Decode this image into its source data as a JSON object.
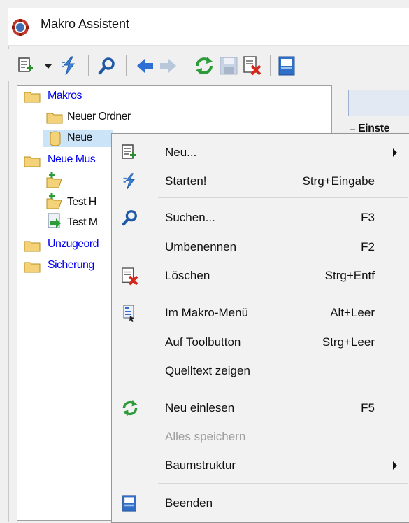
{
  "window": {
    "title": "Makro Assistent",
    "title_icon": "macro-assistant-app-icon"
  },
  "toolbar": {
    "buttons": [
      "new-icon",
      "dropdown-arrow-icon",
      "run-icon",
      "search-icon",
      "back-arrow-icon",
      "forward-arrow-icon",
      "refresh-icon",
      "save-icon",
      "delete-icon",
      "exit-icon"
    ]
  },
  "tree": {
    "items": [
      {
        "label": "Makros",
        "color": "#0000ee"
      },
      {
        "label": "Neuer Ordner",
        "color": "#111111"
      },
      {
        "label": "Neue",
        "color": "#111111",
        "selected": true
      },
      {
        "label": "Neue Mus",
        "color": "#0000ee"
      },
      {
        "label": "",
        "color": "#111111"
      },
      {
        "label": "Test H",
        "color": "#111111"
      },
      {
        "label": "Test M",
        "color": "#111111"
      },
      {
        "label": "Unzugeord",
        "color": "#0000ee"
      },
      {
        "label": "Sicherung",
        "color": "#0000ee"
      }
    ]
  },
  "right_panel": {
    "group_label": "Einste"
  },
  "context_menu": {
    "items": [
      {
        "label": "Neu...",
        "shortcut": "",
        "icon": "new-icon",
        "submenu": true
      },
      {
        "label": "Starten!",
        "shortcut": "Strg+Eingabe",
        "icon": "run-icon"
      },
      {
        "label": "Suchen...",
        "shortcut": "F3",
        "icon": "search-icon"
      },
      {
        "label": "Umbenennen",
        "shortcut": "F2",
        "icon": ""
      },
      {
        "label": "Löschen",
        "shortcut": "Strg+Entf",
        "icon": "delete-icon"
      },
      {
        "label": "Im Makro-Menü",
        "shortcut": "Alt+Leer",
        "icon": "menu-macro-icon"
      },
      {
        "label": "Auf Toolbutton",
        "shortcut": "Strg+Leer",
        "icon": ""
      },
      {
        "label": "Quelltext zeigen",
        "shortcut": "",
        "icon": ""
      },
      {
        "label": "Neu einlesen",
        "shortcut": "F5",
        "icon": "refresh-icon"
      },
      {
        "label": "Alles speichern",
        "shortcut": "",
        "icon": "",
        "disabled": true
      },
      {
        "label": "Baumstruktur",
        "shortcut": "",
        "icon": "",
        "submenu": true
      },
      {
        "label": "Beenden",
        "shortcut": "",
        "icon": "exit-icon"
      }
    ]
  }
}
